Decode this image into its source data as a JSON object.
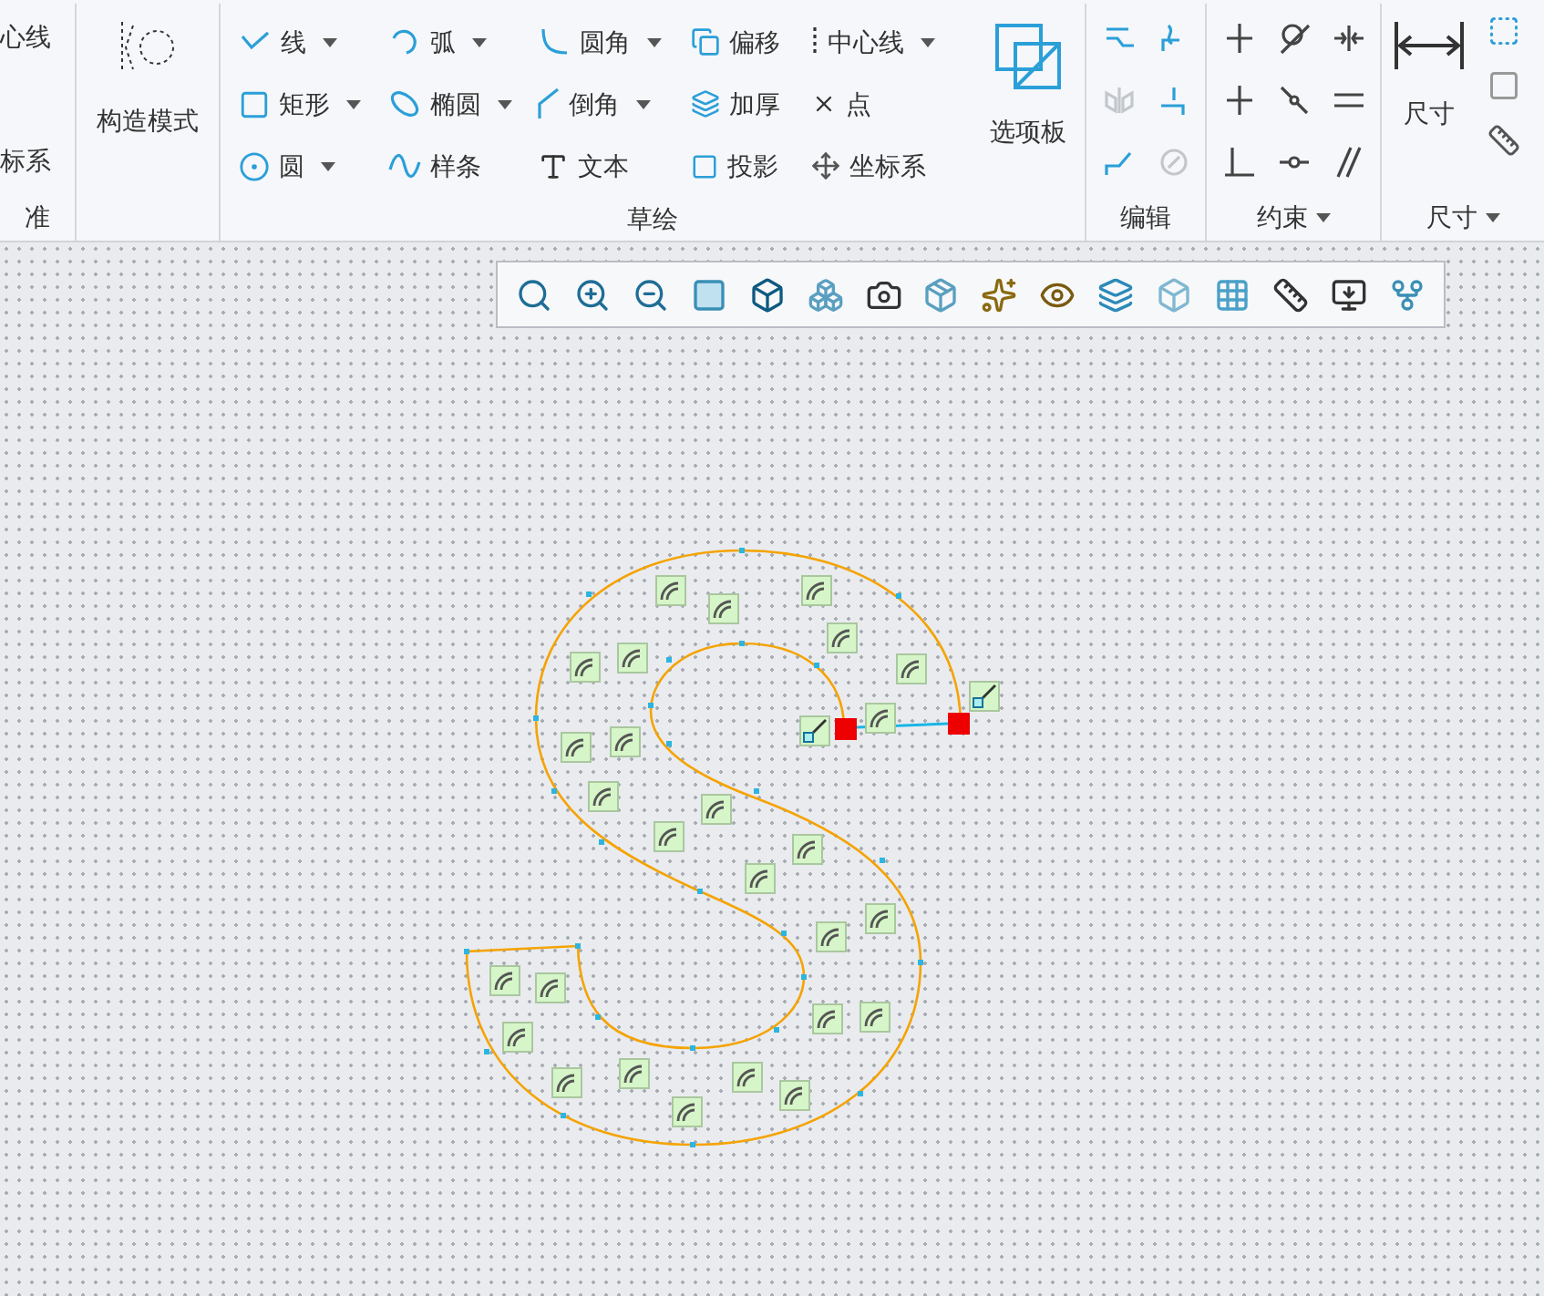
{
  "ribbon": {
    "left_partial": {
      "items": [
        "心线",
        "标系"
      ],
      "group_label": "准"
    },
    "construction_mode": {
      "label": "构造模式"
    },
    "sketch": {
      "columns": [
        [
          {
            "label": "线",
            "dropdown": true
          },
          {
            "label": "矩形",
            "dropdown": true
          },
          {
            "label": "圆",
            "dropdown": true
          }
        ],
        [
          {
            "label": "弧",
            "dropdown": true
          },
          {
            "label": "椭圆",
            "dropdown": true
          },
          {
            "label": "样条",
            "dropdown": false
          }
        ],
        [
          {
            "label": "圆角",
            "dropdown": true
          },
          {
            "label": "倒角",
            "dropdown": true
          },
          {
            "label": "文本",
            "dropdown": false
          }
        ],
        [
          {
            "label": "偏移",
            "dropdown": false
          },
          {
            "label": "加厚",
            "dropdown": false
          },
          {
            "label": "投影",
            "dropdown": false
          }
        ],
        [
          {
            "label": "中心线",
            "dropdown": true
          },
          {
            "label": "点",
            "dropdown": false
          },
          {
            "label": "坐标系",
            "dropdown": false
          }
        ]
      ],
      "palette": "选项板",
      "group_label": "草绘"
    },
    "edit": {
      "tools": [
        {
          "disabled": false
        },
        {
          "disabled": false
        },
        {
          "disabled": true
        },
        {
          "disabled": false
        },
        {
          "disabled": false
        },
        {
          "disabled": true
        }
      ],
      "group_label": "编辑",
      "dropdown": false
    },
    "constraints": {
      "group_label": "约束",
      "dropdown": true
    },
    "dimension": {
      "label": "尺寸",
      "group_label": "尺寸",
      "dropdown": true
    }
  }
}
